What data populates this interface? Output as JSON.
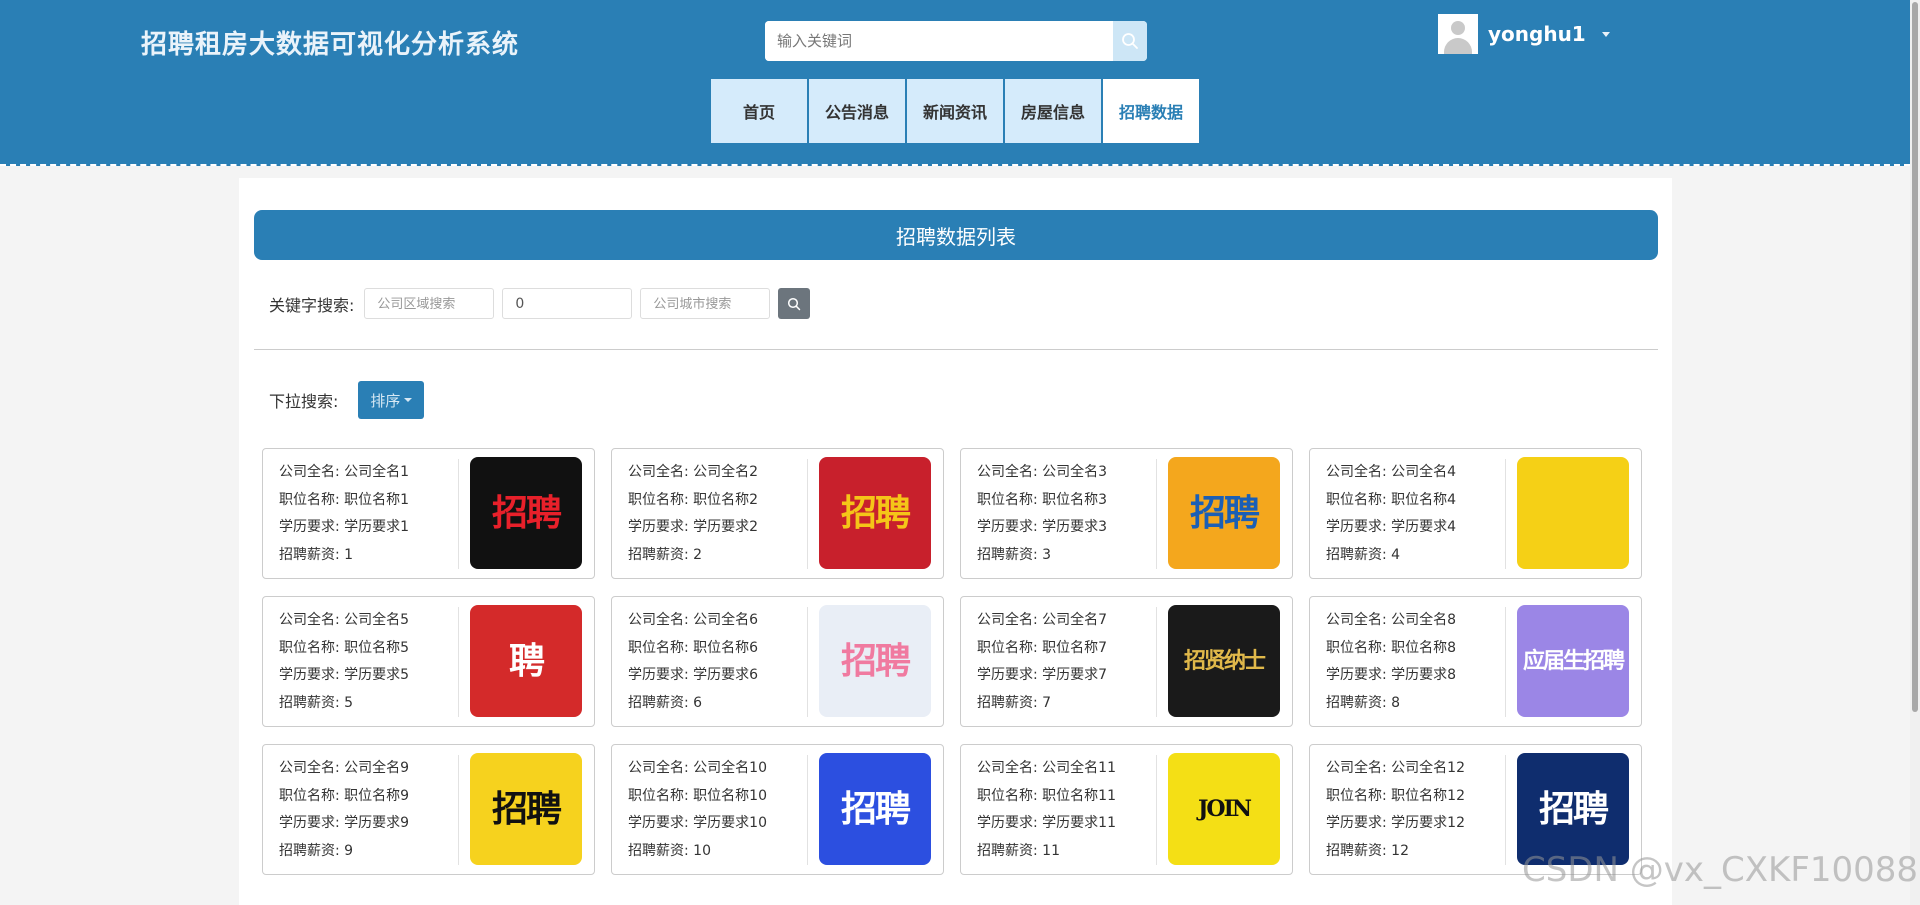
{
  "header": {
    "site_title": "招聘租房大数据可视化分析系统",
    "search_placeholder": "输入关键词",
    "username": "yonghu1"
  },
  "nav": [
    {
      "label": "首页",
      "active": false
    },
    {
      "label": "公告消息",
      "active": false
    },
    {
      "label": "新闻资讯",
      "active": false
    },
    {
      "label": "房屋信息",
      "active": false
    },
    {
      "label": "招聘数据",
      "active": true
    }
  ],
  "list_title": "招聘数据列表",
  "filter": {
    "label": "关键字搜索:",
    "area_placeholder": "公司区域搜索",
    "middle_value": "0",
    "city_placeholder": "公司城市搜索"
  },
  "sort": {
    "label": "下拉搜索:",
    "button_label": "排序"
  },
  "field_labels": {
    "company": "公司全名: ",
    "position": "职位名称: ",
    "education": "学历要求: ",
    "salary": "招聘薪资: "
  },
  "cards": [
    {
      "company": "公司全名1",
      "position": "职位名称1",
      "education": "学历要求1",
      "salary": "1",
      "img_text": "招聘",
      "img_bg": "#111111",
      "img_fg": "#e8202a"
    },
    {
      "company": "公司全名2",
      "position": "职位名称2",
      "education": "学历要求2",
      "salary": "2",
      "img_text": "招聘",
      "img_bg": "#c8202c",
      "img_fg": "#f5c518"
    },
    {
      "company": "公司全名3",
      "position": "职位名称3",
      "education": "学历要求3",
      "salary": "3",
      "img_text": "招聘",
      "img_bg": "#f4a71d",
      "img_fg": "#1b5fb5"
    },
    {
      "company": "公司全名4",
      "position": "职位名称4",
      "education": "学历要求4",
      "salary": "4",
      "img_text": "",
      "img_bg": "#f5d016",
      "img_fg": "#222222"
    },
    {
      "company": "公司全名5",
      "position": "职位名称5",
      "education": "学历要求5",
      "salary": "5",
      "img_text": "聘",
      "img_bg": "#d42a2a",
      "img_fg": "#ffffff"
    },
    {
      "company": "公司全名6",
      "position": "职位名称6",
      "education": "学历要求6",
      "salary": "6",
      "img_text": "招聘",
      "img_bg": "#e9eef6",
      "img_fg": "#f07aa0"
    },
    {
      "company": "公司全名7",
      "position": "职位名称7",
      "education": "学历要求7",
      "salary": "7",
      "img_text": "招贤纳士",
      "img_bg": "#1a1a1a",
      "img_fg": "#e0b84a"
    },
    {
      "company": "公司全名8",
      "position": "职位名称8",
      "education": "学历要求8",
      "salary": "8",
      "img_text": "应届生招聘",
      "img_bg": "#9b86e6",
      "img_fg": "#ffffff"
    },
    {
      "company": "公司全名9",
      "position": "职位名称9",
      "education": "学历要求9",
      "salary": "9",
      "img_text": "招聘",
      "img_bg": "#f6d21e",
      "img_fg": "#111111"
    },
    {
      "company": "公司全名10",
      "position": "职位名称10",
      "education": "学历要求10",
      "salary": "10",
      "img_text": "招聘",
      "img_bg": "#2c4fe0",
      "img_fg": "#ffffff"
    },
    {
      "company": "公司全名11",
      "position": "职位名称11",
      "education": "学历要求11",
      "salary": "11",
      "img_text": "JOIN",
      "img_bg": "#f4df15",
      "img_fg": "#111111"
    },
    {
      "company": "公司全名12",
      "position": "职位名称12",
      "education": "学历要求12",
      "salary": "12",
      "img_text": "招聘",
      "img_bg": "#0f2d6e",
      "img_fg": "#ffffff"
    }
  ],
  "colors": {
    "primary": "#2a7fb5",
    "nav_bg": "#d5ebfb",
    "search_btn_bg": "#cde6f6"
  },
  "watermark": "CSDN @vx_CXKF10088"
}
